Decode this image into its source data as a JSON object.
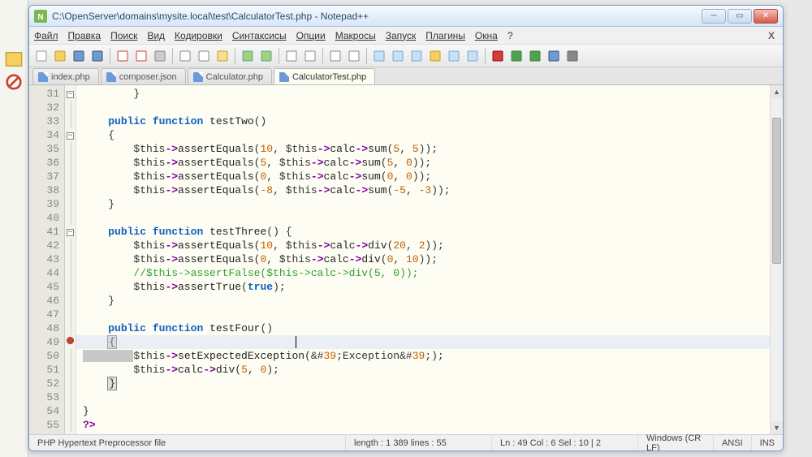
{
  "window": {
    "title": "C:\\OpenServer\\domains\\mysite.local\\test\\CalculatorTest.php - Notepad++"
  },
  "menu": {
    "file": "Файл",
    "edit": "Правка",
    "search": "Поиск",
    "view": "Вид",
    "encoding": "Кодировки",
    "syntax": "Синтаксисы",
    "options": "Опции",
    "macro": "Макросы",
    "run": "Запуск",
    "plugins": "Плагины",
    "windows": "Окна",
    "help": "?",
    "close_doc": "X"
  },
  "tabs": [
    {
      "label": "index.php",
      "active": false
    },
    {
      "label": "composer.json",
      "active": false
    },
    {
      "label": "Calculator.php",
      "active": false
    },
    {
      "label": "CalculatorTest.php",
      "active": true
    }
  ],
  "code": {
    "first_line": 31,
    "lines": [
      "        }",
      "",
      "    public function testTwo()",
      "    {",
      "        $this->assertEquals(10, $this->calc->sum(5, 5));",
      "        $this->assertEquals(5, $this->calc->sum(5, 0));",
      "        $this->assertEquals(0, $this->calc->sum(0, 0));",
      "        $this->assertEquals(-8, $this->calc->sum(-5, -3));",
      "    }",
      "",
      "    public function testThree() {",
      "        $this->assertEquals(10, $this->calc->div(20, 2));",
      "        $this->assertEquals(0, $this->calc->div(0, 10));",
      "        //$this->assertFalse($this->calc->div(5, 0));",
      "        $this->assertTrue(true);",
      "    }",
      "",
      "    public function testFour()",
      "    {",
      "        $this->setExpectedException('Exception');",
      "        $this->calc->div(5, 0);",
      "    }",
      "",
      "}",
      "?>"
    ],
    "caret_line_index": 18,
    "selection_line": 19
  },
  "status": {
    "language": "PHP Hypertext Preprocessor file",
    "length": "length : 1 389    lines : 55",
    "pos": "Ln : 49    Col : 6    Sel : 10 | 2",
    "eol": "Windows (CR LF)",
    "enc": "ANSI",
    "mode": "INS"
  },
  "icons": {
    "new": "new",
    "open": "open",
    "save": "save",
    "saveall": "saveall",
    "close": "close",
    "closeall": "closeall",
    "print": "print",
    "cut": "cut",
    "copy": "copy",
    "paste": "paste",
    "undo": "undo",
    "redo": "redo",
    "find": "find",
    "replace": "replace",
    "zoomin": "zoomin",
    "zoomout": "zoomout",
    "wrap": "wrap",
    "allchars": "allchars",
    "indent": "indent",
    "folder": "folder",
    "func": "func",
    "rec": "rec",
    "play": "play",
    "playm": "playm",
    "saverec": "saverec"
  }
}
